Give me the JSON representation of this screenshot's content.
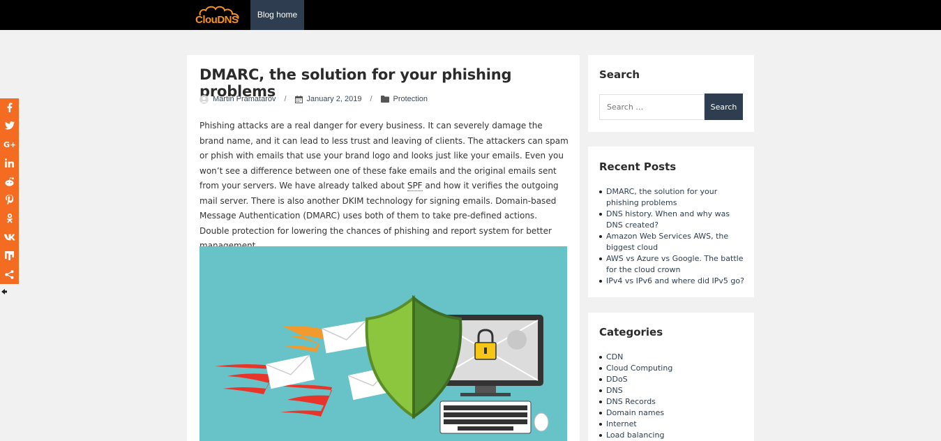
{
  "header": {
    "logo_text": "ClouDNS",
    "nav_blog_home": "Blog home"
  },
  "share_bar": {
    "icons": [
      "facebook-icon",
      "twitter-icon",
      "google-plus-icon",
      "linkedin-icon",
      "reddit-icon",
      "pinterest-icon",
      "odnoklassniki-icon",
      "vk-icon",
      "mix-icon",
      "share-icon"
    ],
    "accent_color": "#f36c21"
  },
  "post": {
    "title": "DMARC, the solution for your phishing problems",
    "author": "Martin Pramatarov",
    "date": "January 2, 2019",
    "category": "Protection",
    "body_before_link": "Phishing attacks are a real danger for every business. It can severely damage the brand name, and it can lead to less trust and leaving of clients. The attackers can spam or phish with emails that use your brand logo and looks just like your emails. Even you won’t see a difference between one of these fake emails and the original emails sent from your servers. We have already talked about ",
    "body_link": "SPF",
    "body_after_link": " and how it verifies the outgoing mail server. There is also another DKIM technology for signing emails. Domain-based Message Authentication (DMARC) uses both of them to take pre-defined actions. Double protection for lowering the chances of phishing and report system for better management."
  },
  "sidebar": {
    "search": {
      "title": "Search",
      "placeholder": "Search …",
      "button": "Search"
    },
    "recent": {
      "title": "Recent Posts",
      "items": [
        "DMARC, the solution for your phishing problems",
        "DNS history. When and why was DNS created?",
        "Amazon Web Services AWS, the biggest cloud",
        "AWS vs Azure vs Google. The battle for the cloud crown",
        "IPv4 vs IPv6 and where did IPv5 go?"
      ]
    },
    "categories": {
      "title": "Categories",
      "items": [
        "CDN",
        "Cloud Computing",
        "DDoS",
        "DNS",
        "DNS Records",
        "Domain names",
        "Internet",
        "Load balancing"
      ]
    }
  },
  "colors": {
    "nav_bg": "#2e3e50",
    "hero_bg": "#67c3c7",
    "brand_orange": "#f7941d"
  }
}
